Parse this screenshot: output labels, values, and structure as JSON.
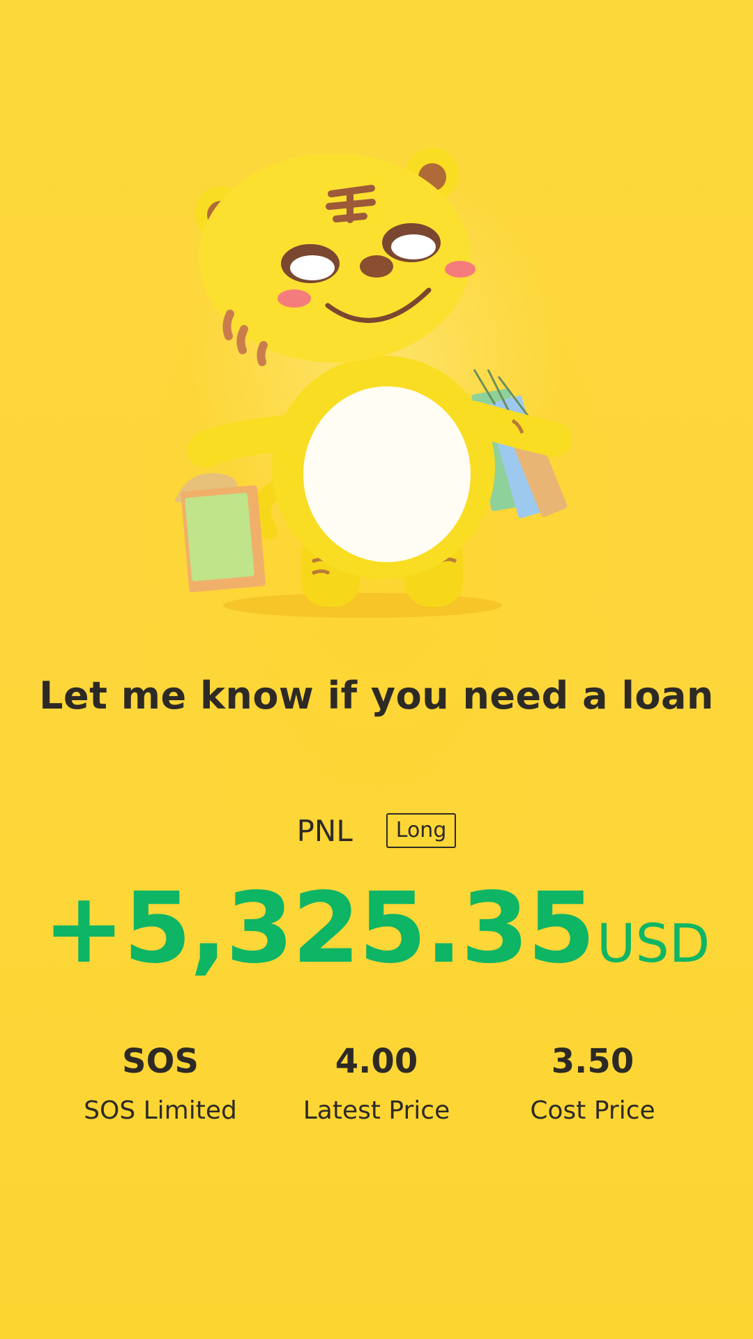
{
  "headline": "Let me know if you need a loan",
  "pnl": {
    "label": "PNL",
    "badge": "Long",
    "amount": "+5,325.35",
    "currency": "USD"
  },
  "stats": [
    {
      "value": "SOS",
      "label": "SOS Limited"
    },
    {
      "value": "4.00",
      "label": "Latest Price"
    },
    {
      "value": "3.50",
      "label": "Cost Price"
    }
  ],
  "colors": {
    "background": "#fdd83a",
    "profit": "#0db565",
    "text": "#2d2a26"
  },
  "illustration": {
    "icon": "tiger-mascot-with-shopping-bags-icon"
  }
}
